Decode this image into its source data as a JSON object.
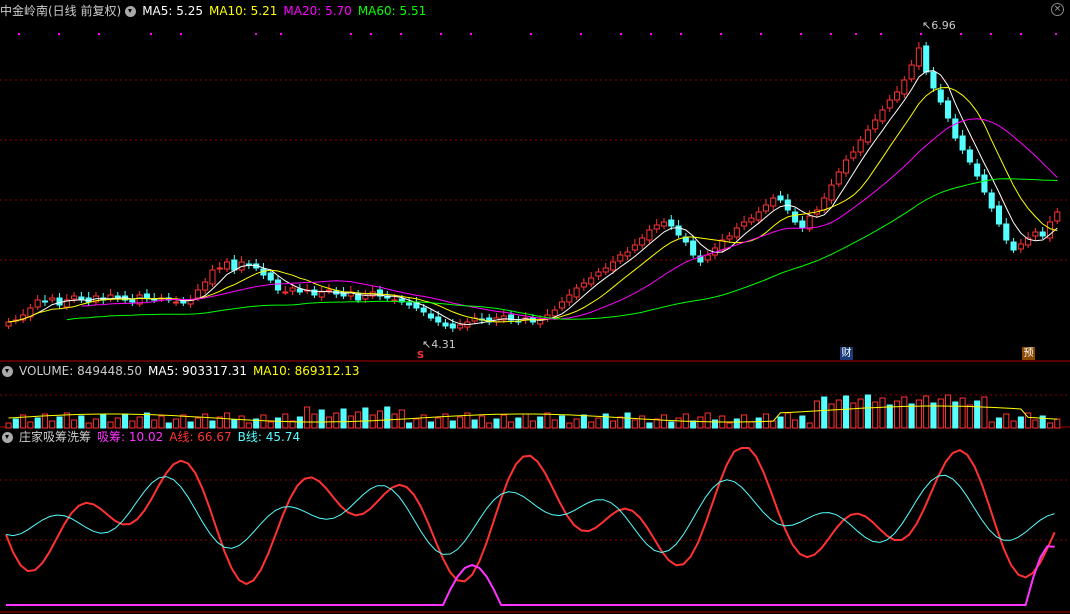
{
  "main_header": {
    "title": "中金岭南(日线 前复权)",
    "ma5": "MA5: 5.25",
    "ma10": "MA10: 5.21",
    "ma20": "MA20: 5.70",
    "ma60": "MA60: 5.51"
  },
  "annotations": {
    "high": "6.96",
    "low": "4.31",
    "event_s": "S",
    "event_cai": "财",
    "event_yu": "预"
  },
  "volume_header": {
    "volume": "VOLUME: 849448.50",
    "ma5": "MA5: 903317.31",
    "ma10": "MA10: 869312.13"
  },
  "indicator_header": {
    "title": "庄家吸筹洗筹",
    "xichou": "吸筹: 10.02",
    "a_line": "A线: 66.67",
    "b_line": "B线: 45.74"
  },
  "colors": {
    "up": "#ff3232",
    "down": "#54ffff",
    "ma5": "#ffffff",
    "ma10": "#ffff00",
    "ma20": "#ff00ff",
    "ma60": "#00ff00",
    "grid": "#8b0000"
  },
  "icons": [
    "chevron-down-icon",
    "close-icon"
  ]
}
